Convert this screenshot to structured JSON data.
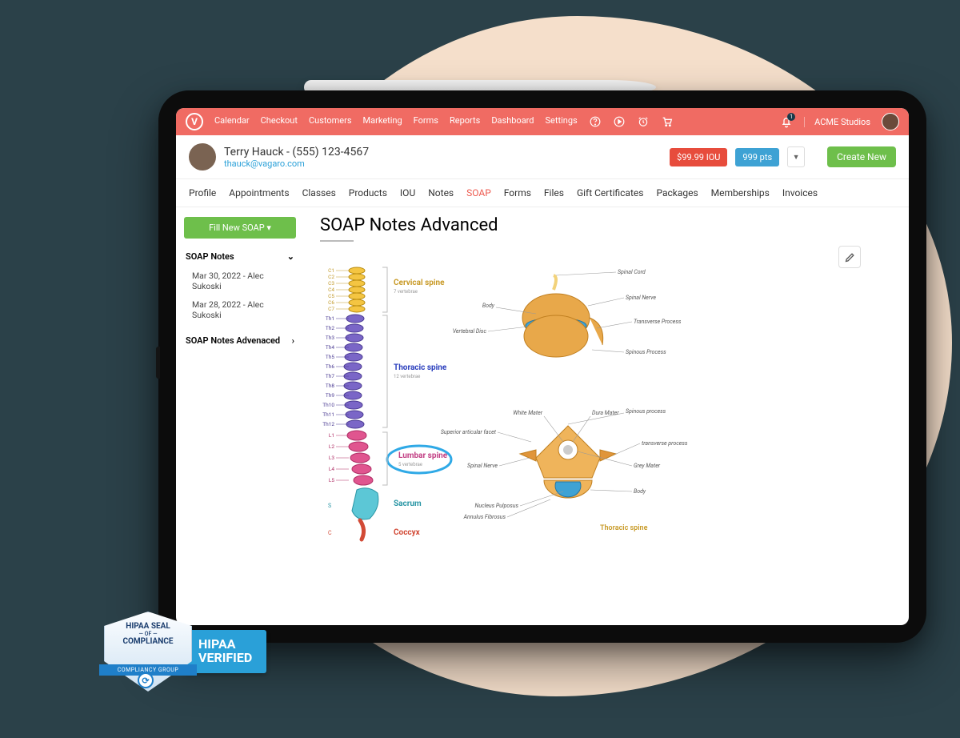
{
  "nav": {
    "links": [
      "Calendar",
      "Checkout",
      "Customers",
      "Marketing",
      "Forms",
      "Reports",
      "Dashboard",
      "Settings"
    ],
    "notification_count": "1",
    "business": "ACME Studios"
  },
  "customer": {
    "name": "Terry Hauck - (555) 123-4567",
    "email": "thauck@vagaro.com",
    "iou_badge": "$99.99 IOU",
    "points_badge": "999 pts",
    "create_new": "Create New"
  },
  "tabs": [
    "Profile",
    "Appointments",
    "Classes",
    "Products",
    "IOU",
    "Notes",
    "SOAP",
    "Forms",
    "Files",
    "Gift Certificates",
    "Packages",
    "Memberships",
    "Invoices"
  ],
  "active_tab": "SOAP",
  "sidebar": {
    "fill_btn": "Fill New SOAP  ▾",
    "group1_title": "SOAP Notes",
    "group1_items": [
      "Mar 30, 2022 - Alec Sukoski",
      "Mar 28, 2022 - Alec Sukoski"
    ],
    "group2_title": "SOAP Notes Advenaced"
  },
  "page_title": "SOAP Notes Advanced",
  "spine": {
    "cervical": {
      "label": "Cervical spine",
      "sub": "7 vertebrae"
    },
    "thoracic": {
      "label": "Thoracic spine",
      "sub": "12 vertebrae"
    },
    "lumbar": {
      "label": "Lumbar spine",
      "sub": "5 vertebrae"
    },
    "sacrum": "Sacrum",
    "coccyx": "Coccyx",
    "cervical_ticks": [
      "C1",
      "C2",
      "C3",
      "C4",
      "C5",
      "C6",
      "C7"
    ],
    "thoracic_ticks": [
      "Th1",
      "Th2",
      "Th3",
      "Th4",
      "Th5",
      "Th6",
      "Th7",
      "Th8",
      "Th9",
      "Th10",
      "Th11",
      "Th12"
    ],
    "lumbar_ticks": [
      "L1",
      "L2",
      "L3",
      "L4",
      "L5"
    ]
  },
  "vertebra_side": {
    "parts": [
      "Spinal Cord",
      "Body",
      "Spinal Nerve",
      "Vertebral Disc",
      "Transverse Process",
      "Spinous Process"
    ]
  },
  "vertebra_top": {
    "title": "Thoracic spine",
    "parts": [
      "White Mater",
      "Dura Mater",
      "Spinous process",
      "transverse process",
      "Grey Mater",
      "Body",
      "Spinal Nerve",
      "Nucleus Pulposus",
      "Annulus Fibrosus",
      "Superior articular facet"
    ]
  },
  "hipaa": {
    "seal_line1": "HIPAA SEAL",
    "seal_of": "— OF —",
    "seal_line2": "COMPLIANCE",
    "seal_banner": "COMPLIANCY GROUP",
    "verified_line1": "HIPAA",
    "verified_line2": "VERIFIED"
  }
}
